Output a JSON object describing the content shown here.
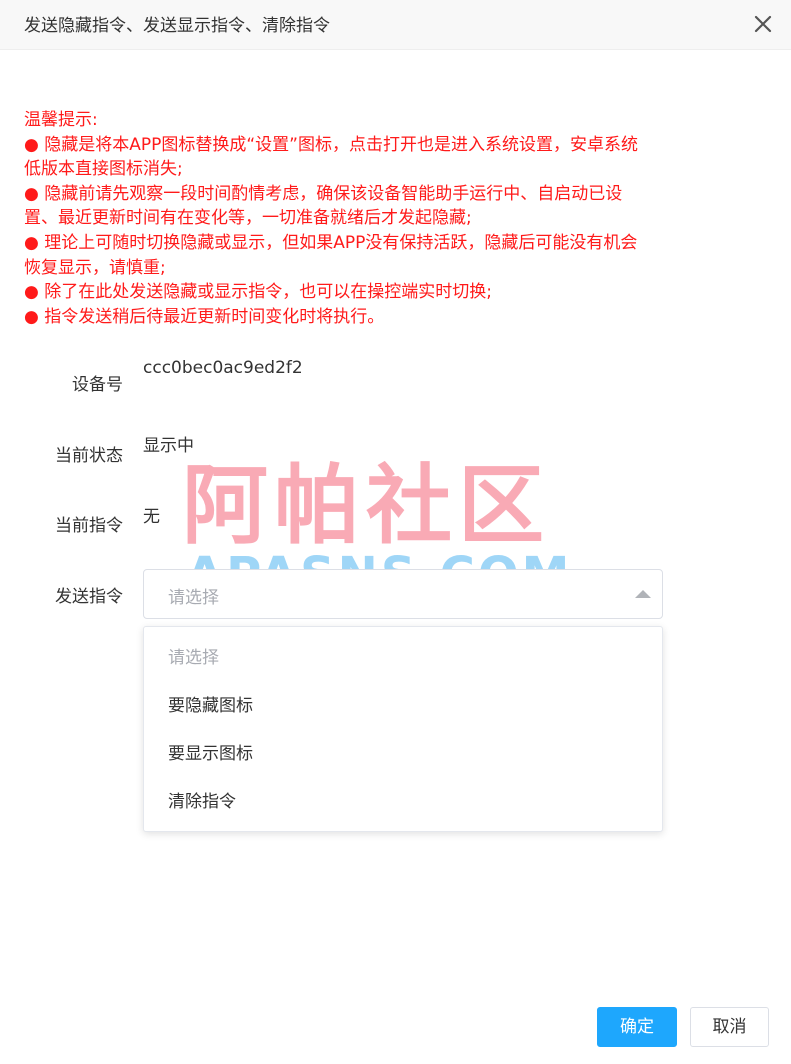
{
  "dialog": {
    "title": "发送隐藏指令、发送显示指令、清除指令",
    "close_icon": "close-icon"
  },
  "notice": {
    "lines": [
      "温馨提示:",
      "● 隐藏是将本APP图标替换成“设置”图标，点击打开也是进入系统设置，安卓系统低版本直接图标消失;",
      "● 隐藏前请先观察一段时间酌情考虑，确保该设备智能助手运行中、自启动已设置、最近更新时间有在变化等，一切准备就绪后才发起隐藏;",
      "● 理论上可随时切换隐藏或显示，但如果APP没有保持活跃，隐藏后可能没有机会恢复显示，请慎重;",
      "● 除了在此处发送隐藏或显示指令，也可以在操控端实时切换;",
      "● 指令发送稍后待最近更新时间变化时将执行。"
    ],
    "color": "#ff1a1a"
  },
  "form": {
    "device_label": "设备号",
    "device_value": "ccc0bec0ac9ed2f2",
    "status_label": "当前状态",
    "status_value": "显示中",
    "command_label": "当前指令",
    "command_value": "无",
    "send_label": "发送指令",
    "select_placeholder": "请选择",
    "options": [
      "请选择",
      "要隐藏图标",
      "要显示图标",
      "清除指令"
    ]
  },
  "watermark": {
    "cn": "阿帕社区",
    "en": "APASNS.COM"
  },
  "buttons": {
    "ok": "确定",
    "cancel": "取消",
    "accent_color": "#1ea7fd"
  }
}
